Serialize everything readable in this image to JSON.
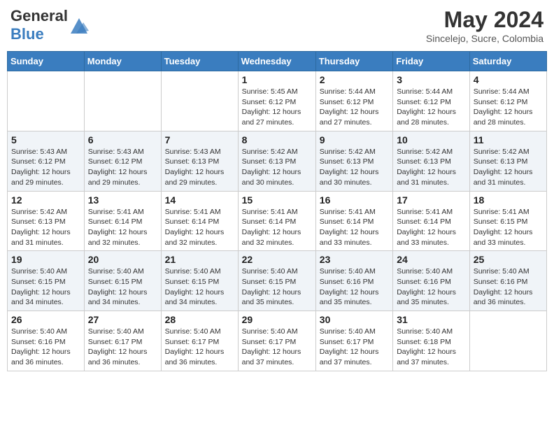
{
  "header": {
    "logo_general": "General",
    "logo_blue": "Blue",
    "title": "May 2024",
    "location": "Sincelejo, Sucre, Colombia"
  },
  "days_of_week": [
    "Sunday",
    "Monday",
    "Tuesday",
    "Wednesday",
    "Thursday",
    "Friday",
    "Saturday"
  ],
  "weeks": [
    [
      {
        "day": "",
        "info": ""
      },
      {
        "day": "",
        "info": ""
      },
      {
        "day": "",
        "info": ""
      },
      {
        "day": "1",
        "info": "Sunrise: 5:45 AM\nSunset: 6:12 PM\nDaylight: 12 hours and 27 minutes."
      },
      {
        "day": "2",
        "info": "Sunrise: 5:44 AM\nSunset: 6:12 PM\nDaylight: 12 hours and 27 minutes."
      },
      {
        "day": "3",
        "info": "Sunrise: 5:44 AM\nSunset: 6:12 PM\nDaylight: 12 hours and 28 minutes."
      },
      {
        "day": "4",
        "info": "Sunrise: 5:44 AM\nSunset: 6:12 PM\nDaylight: 12 hours and 28 minutes."
      }
    ],
    [
      {
        "day": "5",
        "info": "Sunrise: 5:43 AM\nSunset: 6:12 PM\nDaylight: 12 hours and 29 minutes."
      },
      {
        "day": "6",
        "info": "Sunrise: 5:43 AM\nSunset: 6:12 PM\nDaylight: 12 hours and 29 minutes."
      },
      {
        "day": "7",
        "info": "Sunrise: 5:43 AM\nSunset: 6:13 PM\nDaylight: 12 hours and 29 minutes."
      },
      {
        "day": "8",
        "info": "Sunrise: 5:42 AM\nSunset: 6:13 PM\nDaylight: 12 hours and 30 minutes."
      },
      {
        "day": "9",
        "info": "Sunrise: 5:42 AM\nSunset: 6:13 PM\nDaylight: 12 hours and 30 minutes."
      },
      {
        "day": "10",
        "info": "Sunrise: 5:42 AM\nSunset: 6:13 PM\nDaylight: 12 hours and 31 minutes."
      },
      {
        "day": "11",
        "info": "Sunrise: 5:42 AM\nSunset: 6:13 PM\nDaylight: 12 hours and 31 minutes."
      }
    ],
    [
      {
        "day": "12",
        "info": "Sunrise: 5:42 AM\nSunset: 6:13 PM\nDaylight: 12 hours and 31 minutes."
      },
      {
        "day": "13",
        "info": "Sunrise: 5:41 AM\nSunset: 6:14 PM\nDaylight: 12 hours and 32 minutes."
      },
      {
        "day": "14",
        "info": "Sunrise: 5:41 AM\nSunset: 6:14 PM\nDaylight: 12 hours and 32 minutes."
      },
      {
        "day": "15",
        "info": "Sunrise: 5:41 AM\nSunset: 6:14 PM\nDaylight: 12 hours and 32 minutes."
      },
      {
        "day": "16",
        "info": "Sunrise: 5:41 AM\nSunset: 6:14 PM\nDaylight: 12 hours and 33 minutes."
      },
      {
        "day": "17",
        "info": "Sunrise: 5:41 AM\nSunset: 6:14 PM\nDaylight: 12 hours and 33 minutes."
      },
      {
        "day": "18",
        "info": "Sunrise: 5:41 AM\nSunset: 6:15 PM\nDaylight: 12 hours and 33 minutes."
      }
    ],
    [
      {
        "day": "19",
        "info": "Sunrise: 5:40 AM\nSunset: 6:15 PM\nDaylight: 12 hours and 34 minutes."
      },
      {
        "day": "20",
        "info": "Sunrise: 5:40 AM\nSunset: 6:15 PM\nDaylight: 12 hours and 34 minutes."
      },
      {
        "day": "21",
        "info": "Sunrise: 5:40 AM\nSunset: 6:15 PM\nDaylight: 12 hours and 34 minutes."
      },
      {
        "day": "22",
        "info": "Sunrise: 5:40 AM\nSunset: 6:15 PM\nDaylight: 12 hours and 35 minutes."
      },
      {
        "day": "23",
        "info": "Sunrise: 5:40 AM\nSunset: 6:16 PM\nDaylight: 12 hours and 35 minutes."
      },
      {
        "day": "24",
        "info": "Sunrise: 5:40 AM\nSunset: 6:16 PM\nDaylight: 12 hours and 35 minutes."
      },
      {
        "day": "25",
        "info": "Sunrise: 5:40 AM\nSunset: 6:16 PM\nDaylight: 12 hours and 36 minutes."
      }
    ],
    [
      {
        "day": "26",
        "info": "Sunrise: 5:40 AM\nSunset: 6:16 PM\nDaylight: 12 hours and 36 minutes."
      },
      {
        "day": "27",
        "info": "Sunrise: 5:40 AM\nSunset: 6:17 PM\nDaylight: 12 hours and 36 minutes."
      },
      {
        "day": "28",
        "info": "Sunrise: 5:40 AM\nSunset: 6:17 PM\nDaylight: 12 hours and 36 minutes."
      },
      {
        "day": "29",
        "info": "Sunrise: 5:40 AM\nSunset: 6:17 PM\nDaylight: 12 hours and 37 minutes."
      },
      {
        "day": "30",
        "info": "Sunrise: 5:40 AM\nSunset: 6:17 PM\nDaylight: 12 hours and 37 minutes."
      },
      {
        "day": "31",
        "info": "Sunrise: 5:40 AM\nSunset: 6:18 PM\nDaylight: 12 hours and 37 minutes."
      },
      {
        "day": "",
        "info": ""
      }
    ]
  ]
}
